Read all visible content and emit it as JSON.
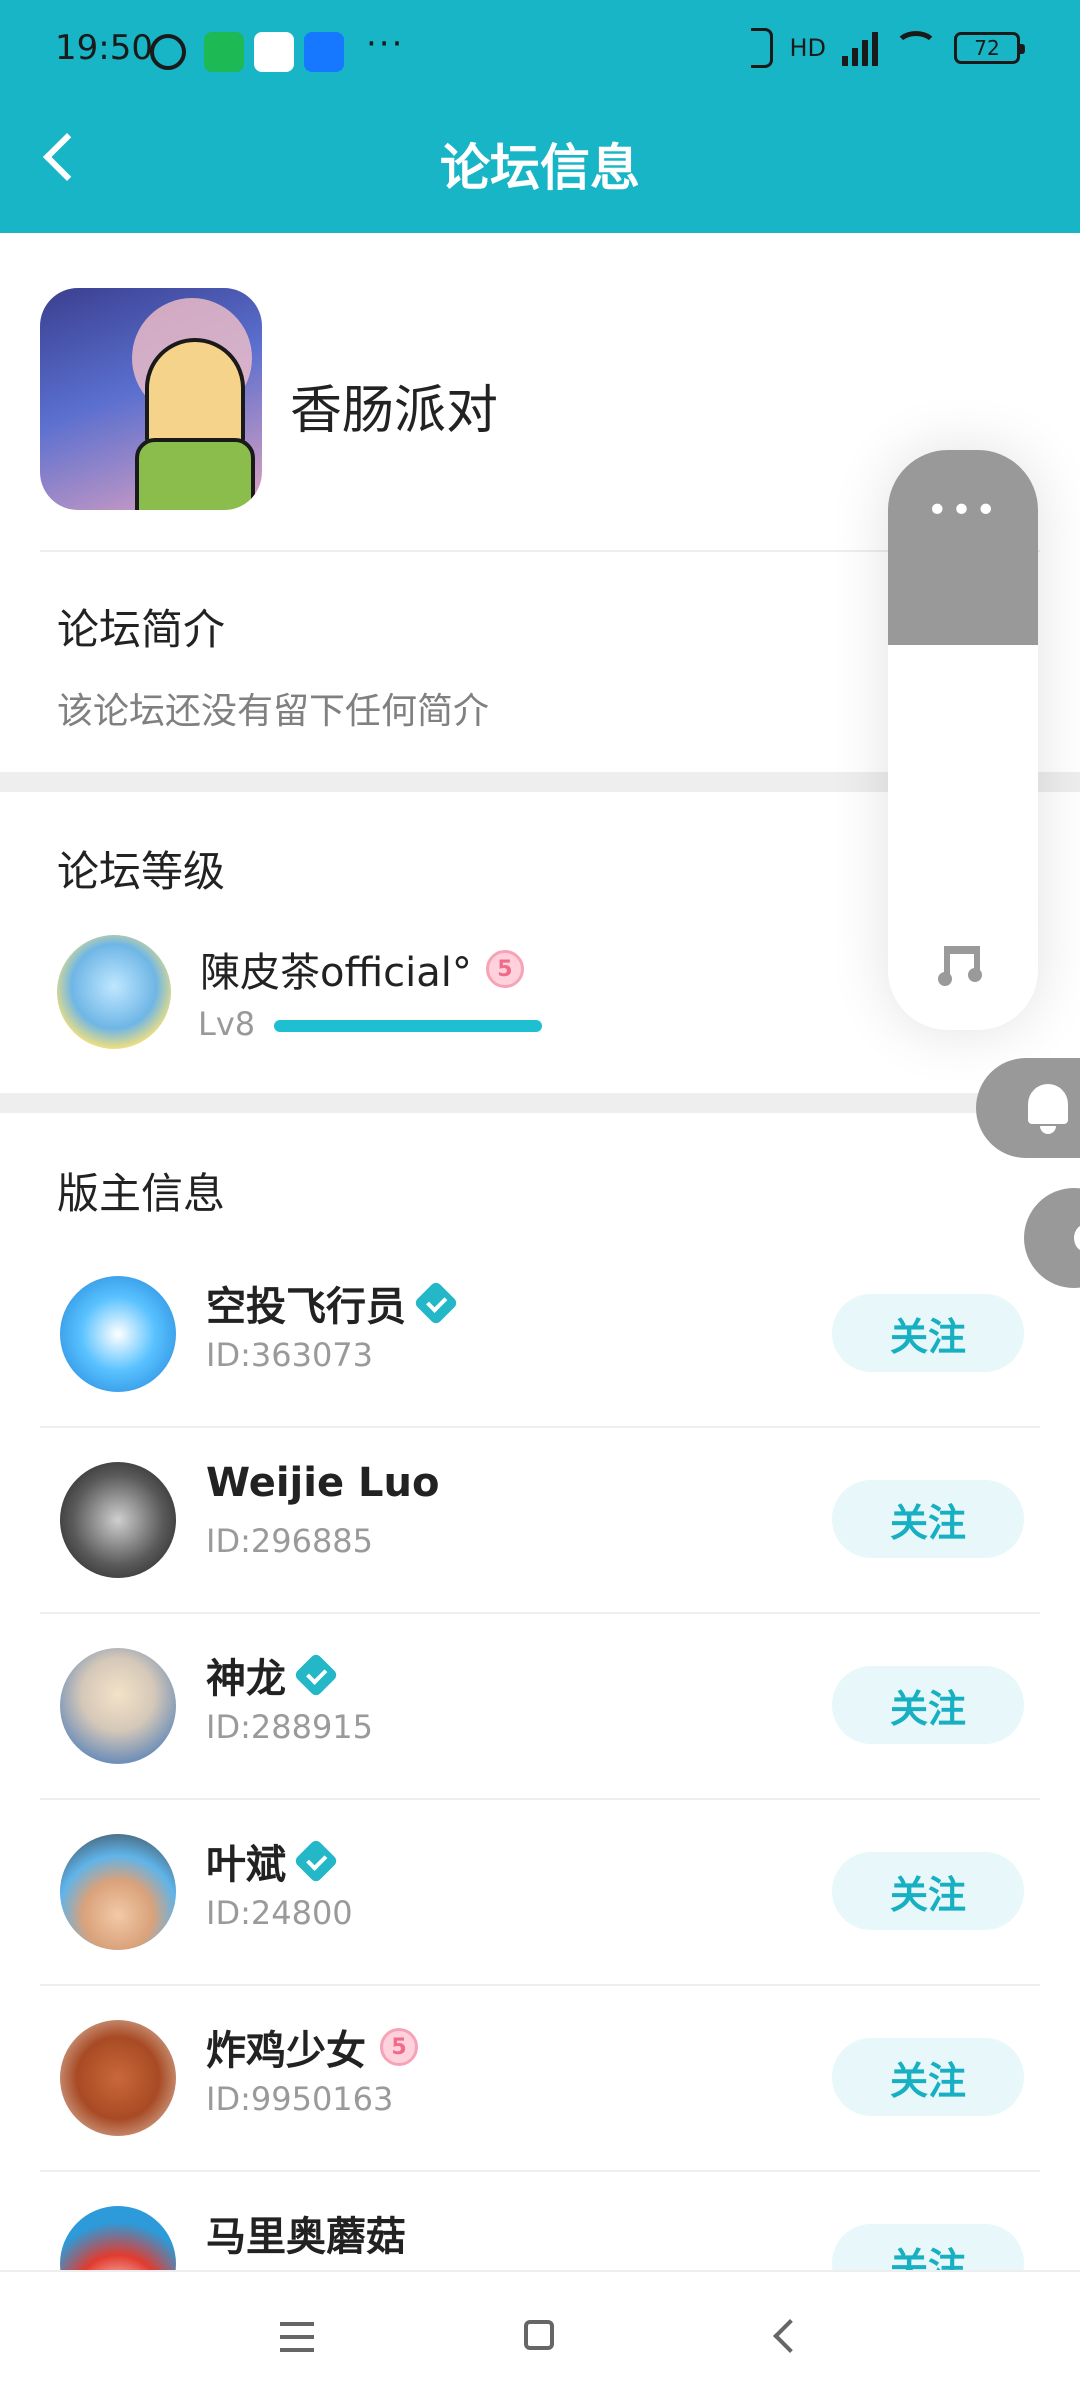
{
  "status": {
    "time": "19:50",
    "battery": "72",
    "network": "HD"
  },
  "header": {
    "title": "论坛信息"
  },
  "forum": {
    "name": "香肠派对",
    "intro_title": "论坛简介",
    "intro_text": "该论坛还没有留下任何简介",
    "level_title": "论坛等级",
    "level_user": "陳皮茶official°",
    "level_badge": "5",
    "level_label": "Lv8",
    "level_progress": 1.0
  },
  "moderators": {
    "title": "版主信息",
    "follow_label": "关注",
    "items": [
      {
        "name": "空投飞行员",
        "id": "ID:363073",
        "verified": true
      },
      {
        "name": "Weijie  Luo",
        "id": "ID:296885",
        "verified": false
      },
      {
        "name": "神龙",
        "id": "ID:288915",
        "verified": true
      },
      {
        "name": "叶斌",
        "id": "ID:24800",
        "verified": true
      },
      {
        "name": "炸鸡少女",
        "id": "ID:9950163",
        "verified": false,
        "badge": "5"
      },
      {
        "name": "马里奥蘑菇",
        "id": "",
        "verified": false
      }
    ]
  },
  "float_panel": {
    "dots": "•••"
  },
  "colors": {
    "accent": "#17b5c6",
    "follow_bg": "#e8f7f9",
    "follow_text": "#17b0c2"
  }
}
